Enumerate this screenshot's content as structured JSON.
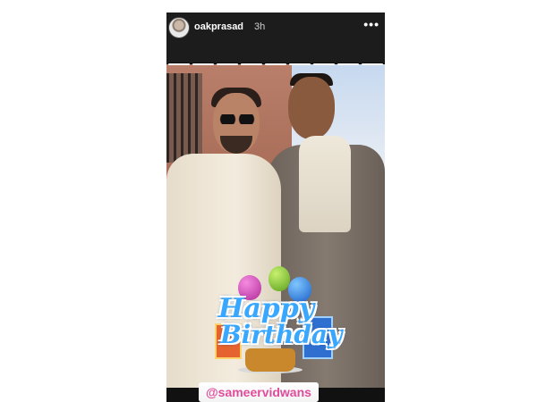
{
  "story": {
    "username": "oakprasad",
    "time": "3h",
    "mention": "@sameervidwans",
    "sticker": {
      "line1": "Happy",
      "line2": "Birthday"
    },
    "progress": {
      "segments_total": 9,
      "segments_done": 9
    }
  },
  "colors": {
    "mention_text": "#e14b9b",
    "sticker_blue": "#3aa7ff"
  },
  "icons": {
    "more": "more-dots-icon"
  }
}
